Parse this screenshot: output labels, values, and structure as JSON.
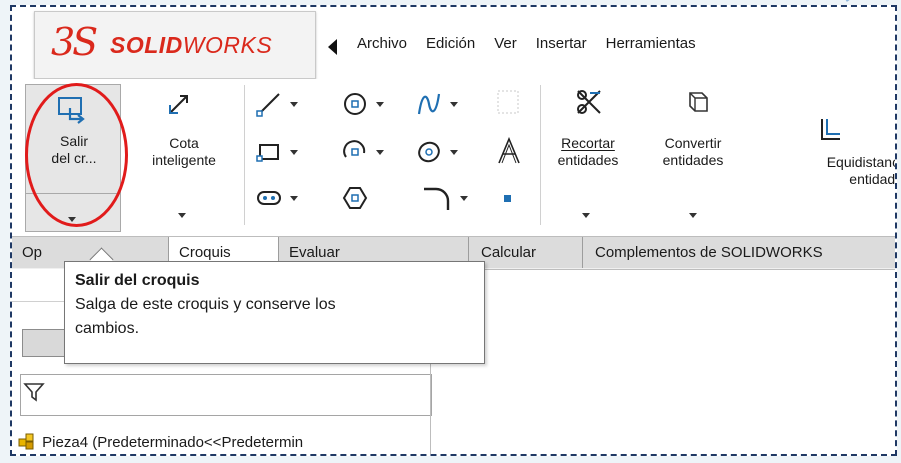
{
  "brand": {
    "ds": "3S",
    "name_bold": "SOLID",
    "name_light": "WORKS",
    "color": "#da291c"
  },
  "menu": [
    "Archivo",
    "Edición",
    "Ver",
    "Insertar",
    "Herramientas"
  ],
  "ribbon": {
    "exit_sketch": {
      "line1": "Salir",
      "line2": "del cr...",
      "icon": "exit-sketch-icon"
    },
    "smart_dimension": {
      "line1": "Cota",
      "line2": "inteligente",
      "icon": "smart-dimension-icon"
    },
    "trim": {
      "line1": "Recortar",
      "line2": "entidades",
      "icon": "trim-icon"
    },
    "convert": {
      "line1": "Convertir",
      "line2": "entidades",
      "icon": "convert-icon"
    },
    "offset": {
      "line1": "Equidistancia",
      "line2": "entidades",
      "icon": "offset-icon"
    },
    "sketch_tools": [
      "line-icon",
      "circle-icon",
      "spline-icon",
      "rectangle-icon",
      "arc-icon",
      "ellipse-icon",
      "text-icon",
      "slot-icon",
      "polygon-icon",
      "fillet-icon",
      "point-icon"
    ]
  },
  "tabs": [
    "Op",
    "Croquis",
    "Evaluar",
    "Calcular",
    "Complementos de SOLIDWORKS"
  ],
  "tooltip": {
    "title": "Salir del croquis",
    "line1": "Salga de este croquis y conserve los",
    "line2": "cambios."
  },
  "tree": {
    "part_label": "Pieza4  (Predeterminado<<Predetermin"
  },
  "colors": {
    "highlight": "#e11b1b",
    "frame": "#1f3864"
  }
}
